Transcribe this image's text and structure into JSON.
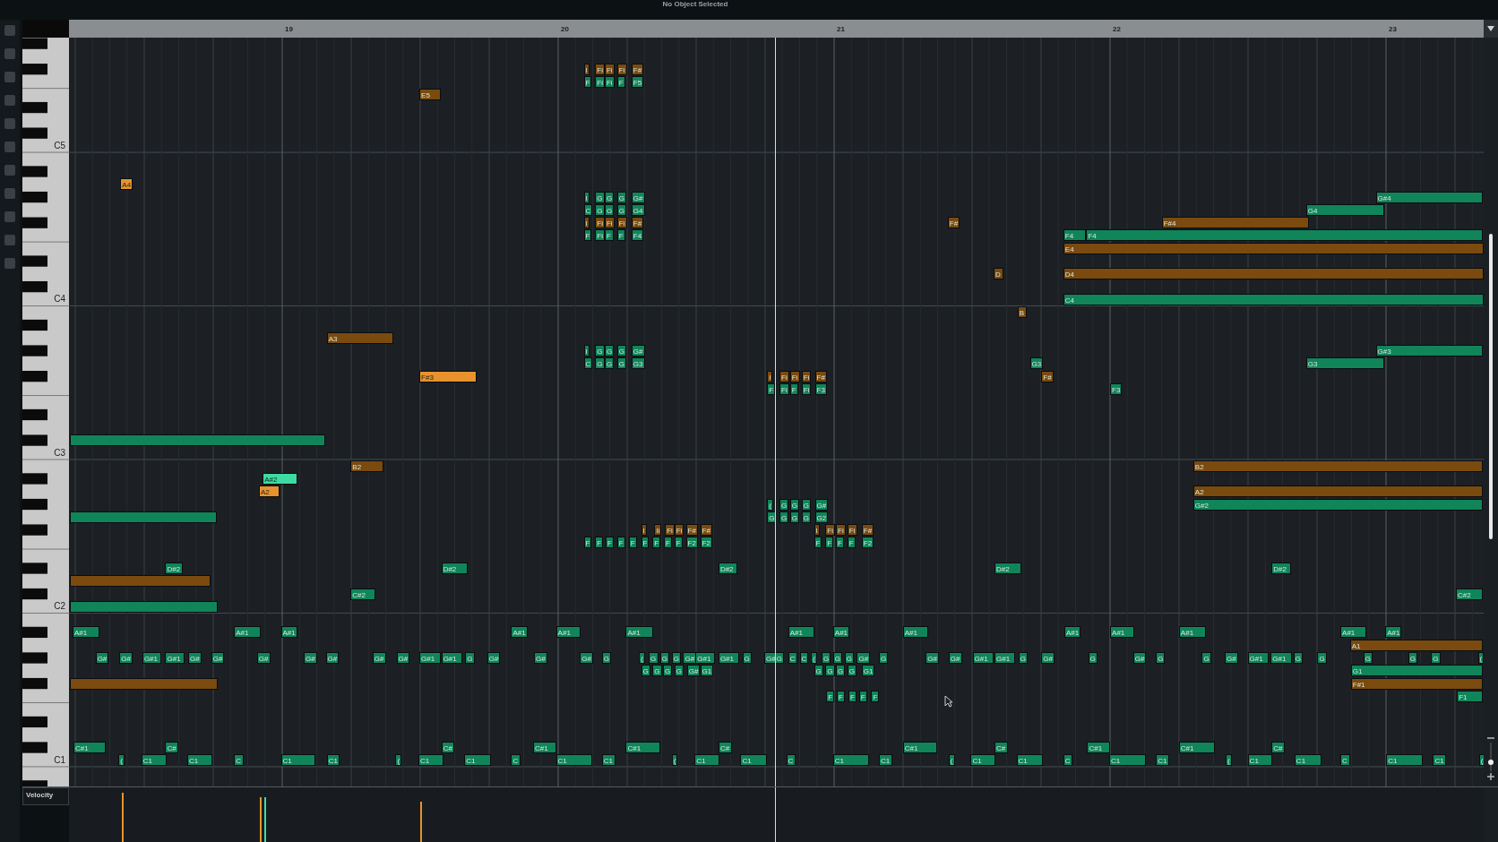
{
  "title": "No Object Selected",
  "ruler": {
    "bars": [
      "19",
      "20",
      "21",
      "22",
      "23"
    ]
  },
  "keyboard": {
    "octave_labels": [
      "C5",
      "C4",
      "C3",
      "C2",
      "C1"
    ]
  },
  "notes": [
    {
      "label": "I",
      "color": "#7a4a0e"
    },
    {
      "label": "Fi",
      "color": "#7a4a0e"
    },
    {
      "label": "Fi",
      "color": "#7a4a0e"
    },
    {
      "label": "Fi",
      "color": "#7a4a0e"
    },
    {
      "label": "F#",
      "color": "#7a4a0e"
    },
    {
      "label": "F",
      "color": "#10855a"
    },
    {
      "label": "Fi",
      "color": "#10855a"
    },
    {
      "label": "Fi",
      "color": "#10855a"
    },
    {
      "label": "F",
      "color": "#10855a"
    },
    {
      "label": "F5",
      "color": "#10855a"
    },
    {
      "label": "E5",
      "color": "#7a4a0e"
    },
    {
      "label": "A4",
      "color": "#e8922e"
    },
    {
      "label": "I",
      "color": "#10855a"
    },
    {
      "label": "G",
      "color": "#10855a"
    },
    {
      "label": "G",
      "color": "#10855a"
    },
    {
      "label": "G",
      "color": "#10855a"
    },
    {
      "label": "G#",
      "color": "#10855a"
    },
    {
      "label": "C",
      "color": "#10855a"
    },
    {
      "label": "G",
      "color": "#10855a"
    },
    {
      "label": "G",
      "color": "#10855a"
    },
    {
      "label": "G",
      "color": "#10855a"
    },
    {
      "label": "G4",
      "color": "#10855a"
    },
    {
      "label": "I",
      "color": "#7a4a0e"
    },
    {
      "label": "Fi",
      "color": "#7a4a0e"
    },
    {
      "label": "Fi",
      "color": "#7a4a0e"
    },
    {
      "label": "Fi",
      "color": "#7a4a0e"
    },
    {
      "label": "F#",
      "color": "#7a4a0e"
    },
    {
      "label": "F",
      "color": "#10855a"
    },
    {
      "label": "Fi",
      "color": "#10855a"
    },
    {
      "label": "F",
      "color": "#10855a"
    },
    {
      "label": "F",
      "color": "#10855a"
    },
    {
      "label": "F4",
      "color": "#10855a"
    },
    {
      "label": "F#",
      "color": "#7a4a0e"
    },
    {
      "label": "G#4",
      "color": "#10855a"
    },
    {
      "label": "G4",
      "color": "#10855a"
    },
    {
      "label": "F#4",
      "color": "#7a4a0e"
    },
    {
      "label": "F4",
      "color": "#10855a"
    },
    {
      "label": "F4",
      "color": "#10855a"
    },
    {
      "label": "E4",
      "color": "#7a4a0e"
    },
    {
      "label": "D",
      "color": "#7a4a0e"
    },
    {
      "label": "D4",
      "color": "#7a4a0e"
    },
    {
      "label": "C4",
      "color": "#10855a"
    },
    {
      "label": "B",
      "color": "#7a4a0e"
    },
    {
      "label": "A3",
      "color": "#7a4a0e"
    },
    {
      "label": "I",
      "color": "#10855a"
    },
    {
      "label": "G",
      "color": "#10855a"
    },
    {
      "label": "G",
      "color": "#10855a"
    },
    {
      "label": "G",
      "color": "#10855a"
    },
    {
      "label": "G#",
      "color": "#10855a"
    },
    {
      "label": "C",
      "color": "#10855a"
    },
    {
      "label": "G",
      "color": "#10855a"
    },
    {
      "label": "G",
      "color": "#10855a"
    },
    {
      "label": "G",
      "color": "#10855a"
    },
    {
      "label": "G3",
      "color": "#10855a"
    },
    {
      "label": "G#3",
      "color": "#10855a"
    },
    {
      "label": "G3",
      "color": "#10855a"
    },
    {
      "label": "G3",
      "color": "#10855a"
    },
    {
      "label": "F#",
      "color": "#7a4a0e"
    },
    {
      "label": "F3",
      "color": "#10855a"
    },
    {
      "label": "F#3",
      "color": "#e8922e"
    },
    {
      "label": "I",
      "color": "#7a4a0e"
    },
    {
      "label": "Fi",
      "color": "#7a4a0e"
    },
    {
      "label": "Fi",
      "color": "#7a4a0e"
    },
    {
      "label": "Fi",
      "color": "#7a4a0e"
    },
    {
      "label": "F#",
      "color": "#7a4a0e"
    },
    {
      "label": "F",
      "color": "#10855a"
    },
    {
      "label": "Fi",
      "color": "#10855a"
    },
    {
      "label": "F",
      "color": "#10855a"
    },
    {
      "label": "Fi",
      "color": "#10855a"
    },
    {
      "label": "F3",
      "color": "#10855a"
    },
    {
      "color": "#10855a"
    },
    {
      "label": "B2",
      "color": "#7a4a0e"
    },
    {
      "label": "B2",
      "color": "#7a4a0e"
    },
    {
      "label": "A#2",
      "color": "#3ddba2"
    },
    {
      "label": "A2",
      "color": "#e8922e"
    },
    {
      "label": "A2",
      "color": "#7a4a0e"
    },
    {
      "label": "(",
      "color": "#10855a"
    },
    {
      "label": "G",
      "color": "#10855a"
    },
    {
      "label": "G",
      "color": "#10855a"
    },
    {
      "label": "G",
      "color": "#10855a"
    },
    {
      "label": "G#",
      "color": "#10855a"
    },
    {
      "label": "G#2",
      "color": "#10855a"
    },
    {
      "label": "G",
      "color": "#10855a"
    },
    {
      "label": "G",
      "color": "#10855a"
    },
    {
      "label": "G",
      "color": "#10855a"
    },
    {
      "label": "G",
      "color": "#10855a"
    },
    {
      "label": "G2",
      "color": "#10855a"
    },
    {
      "color": "#10855a"
    },
    {
      "label": "I",
      "color": "#7a4a0e"
    },
    {
      "label": "Ii",
      "color": "#7a4a0e"
    },
    {
      "label": "Fi",
      "color": "#7a4a0e"
    },
    {
      "label": "Fi",
      "color": "#7a4a0e"
    },
    {
      "label": "F#",
      "color": "#7a4a0e"
    },
    {
      "label": "F#",
      "color": "#7a4a0e"
    },
    {
      "label": "I",
      "color": "#7a4a0e"
    },
    {
      "label": "Fi",
      "color": "#7a4a0e"
    },
    {
      "label": "Fi",
      "color": "#7a4a0e"
    },
    {
      "label": "Fi",
      "color": "#7a4a0e"
    },
    {
      "label": "F#",
      "color": "#7a4a0e"
    },
    {
      "label": "F",
      "color": "#10855a"
    },
    {
      "label": "F",
      "color": "#10855a"
    },
    {
      "label": "F",
      "color": "#10855a"
    },
    {
      "label": "F",
      "color": "#10855a"
    },
    {
      "label": "F",
      "color": "#10855a"
    },
    {
      "label": "F",
      "color": "#10855a"
    },
    {
      "label": "F",
      "color": "#10855a"
    },
    {
      "label": "F",
      "color": "#10855a"
    },
    {
      "label": "F",
      "color": "#10855a"
    },
    {
      "label": "F2",
      "color": "#10855a"
    },
    {
      "label": "F2",
      "color": "#10855a"
    },
    {
      "label": "F",
      "color": "#10855a"
    },
    {
      "label": "F",
      "color": "#10855a"
    },
    {
      "label": "F",
      "color": "#10855a"
    },
    {
      "label": "F",
      "color": "#10855a"
    },
    {
      "label": "F2",
      "color": "#10855a"
    },
    {
      "label": "D#2",
      "color": "#10855a"
    },
    {
      "label": "D#2",
      "color": "#10855a"
    },
    {
      "label": "D#2",
      "color": "#10855a"
    },
    {
      "label": "D#2",
      "color": "#10855a"
    },
    {
      "label": "D#2",
      "color": "#10855a"
    },
    {
      "color": "#7a4a0e"
    },
    {
      "label": "C#2",
      "color": "#10855a"
    },
    {
      "label": "C#2",
      "color": "#10855a"
    },
    {
      "color": "#10855a"
    },
    {
      "label": "A#1",
      "color": "#10855a"
    },
    {
      "label": "A#1",
      "color": "#10855a"
    },
    {
      "label": "A#1",
      "color": "#10855a"
    },
    {
      "label": "A#1",
      "color": "#10855a"
    },
    {
      "label": "A#1",
      "color": "#10855a"
    },
    {
      "label": "A#1",
      "color": "#10855a"
    },
    {
      "label": "A#1",
      "color": "#10855a"
    },
    {
      "label": "A#1",
      "color": "#10855a"
    },
    {
      "label": "A#1",
      "color": "#10855a"
    },
    {
      "label": "A#1",
      "color": "#10855a"
    },
    {
      "label": "A#1",
      "color": "#10855a"
    },
    {
      "label": "A#1",
      "color": "#10855a"
    },
    {
      "label": "A#1",
      "color": "#10855a"
    },
    {
      "label": "A#1",
      "color": "#10855a"
    },
    {
      "label": "A1",
      "color": "#7a4a0e"
    },
    {
      "label": "G#",
      "color": "#10855a"
    },
    {
      "label": "G#",
      "color": "#10855a"
    },
    {
      "label": "G#1",
      "color": "#10855a"
    },
    {
      "label": "G#1",
      "color": "#10855a"
    },
    {
      "label": "G#",
      "color": "#10855a"
    },
    {
      "label": "G#",
      "color": "#10855a"
    },
    {
      "label": "G#",
      "color": "#10855a"
    },
    {
      "label": "G#",
      "color": "#10855a"
    },
    {
      "label": "G#",
      "color": "#10855a"
    },
    {
      "label": "G#",
      "color": "#10855a"
    },
    {
      "label": "G#",
      "color": "#10855a"
    },
    {
      "label": "G#1",
      "color": "#10855a"
    },
    {
      "label": "G#1",
      "color": "#10855a"
    },
    {
      "label": "G",
      "color": "#10855a"
    },
    {
      "label": "G#",
      "color": "#10855a"
    },
    {
      "label": "G#",
      "color": "#10855a"
    },
    {
      "label": "G#",
      "color": "#10855a"
    },
    {
      "label": "G",
      "color": "#10855a"
    },
    {
      "label": "(",
      "color": "#10855a"
    },
    {
      "label": "G",
      "color": "#10855a"
    },
    {
      "label": "G",
      "color": "#10855a"
    },
    {
      "label": "G",
      "color": "#10855a"
    },
    {
      "label": "G#",
      "color": "#10855a"
    },
    {
      "label": "G#1",
      "color": "#10855a"
    },
    {
      "label": "G#1",
      "color": "#10855a"
    },
    {
      "label": "G",
      "color": "#10855a"
    },
    {
      "label": "G#",
      "color": "#10855a"
    },
    {
      "label": "G",
      "color": "#10855a"
    },
    {
      "label": "C",
      "color": "#10855a"
    },
    {
      "label": "C",
      "color": "#10855a"
    },
    {
      "label": "(",
      "color": "#10855a"
    },
    {
      "label": "G",
      "color": "#10855a"
    },
    {
      "label": "G",
      "color": "#10855a"
    },
    {
      "label": "G",
      "color": "#10855a"
    },
    {
      "label": "G#",
      "color": "#10855a"
    },
    {
      "label": "G",
      "color": "#10855a"
    },
    {
      "label": "G#",
      "color": "#10855a"
    },
    {
      "label": "G#",
      "color": "#10855a"
    },
    {
      "label": "G#1",
      "color": "#10855a"
    },
    {
      "label": "G#1",
      "color": "#10855a"
    },
    {
      "label": "G",
      "color": "#10855a"
    },
    {
      "label": "G#",
      "color": "#10855a"
    },
    {
      "label": "G",
      "color": "#10855a"
    },
    {
      "label": "G#",
      "color": "#10855a"
    },
    {
      "label": "G",
      "color": "#10855a"
    },
    {
      "label": "G",
      "color": "#10855a"
    },
    {
      "label": "G#",
      "color": "#10855a"
    },
    {
      "label": "G#1",
      "color": "#10855a"
    },
    {
      "label": "G#1",
      "color": "#10855a"
    },
    {
      "label": "G",
      "color": "#10855a"
    },
    {
      "label": "G",
      "color": "#10855a"
    },
    {
      "label": "G",
      "color": "#10855a"
    },
    {
      "label": "G",
      "color": "#10855a"
    },
    {
      "label": "G",
      "color": "#10855a"
    },
    {
      "label": "(",
      "color": "#10855a"
    },
    {
      "label": "G",
      "color": "#10855a"
    },
    {
      "label": "G",
      "color": "#10855a"
    },
    {
      "label": "G",
      "color": "#10855a"
    },
    {
      "label": "G",
      "color": "#10855a"
    },
    {
      "label": "G#",
      "color": "#10855a"
    },
    {
      "label": "G1",
      "color": "#10855a"
    },
    {
      "label": "G",
      "color": "#10855a"
    },
    {
      "label": "G",
      "color": "#10855a"
    },
    {
      "label": "G",
      "color": "#10855a"
    },
    {
      "label": "G",
      "color": "#10855a"
    },
    {
      "label": "G1",
      "color": "#10855a"
    },
    {
      "label": "G1",
      "color": "#10855a"
    },
    {
      "color": "#7a4a0e"
    },
    {
      "label": "F#1",
      "color": "#7a4a0e"
    },
    {
      "label": "F",
      "color": "#10855a"
    },
    {
      "label": "F",
      "color": "#10855a"
    },
    {
      "label": "F",
      "color": "#10855a"
    },
    {
      "label": "F",
      "color": "#10855a"
    },
    {
      "label": "F",
      "color": "#10855a"
    },
    {
      "label": "F1",
      "color": "#10855a"
    },
    {
      "label": "C#1",
      "color": "#10855a"
    },
    {
      "label": "C#",
      "color": "#10855a"
    },
    {
      "label": "C#",
      "color": "#10855a"
    },
    {
      "label": "C#1",
      "color": "#10855a"
    },
    {
      "label": "C#1",
      "color": "#10855a"
    },
    {
      "label": "C#",
      "color": "#10855a"
    },
    {
      "label": "C#1",
      "color": "#10855a"
    },
    {
      "label": "C#",
      "color": "#10855a"
    },
    {
      "label": "C#1",
      "color": "#10855a"
    },
    {
      "label": "C#1",
      "color": "#10855a"
    },
    {
      "label": "C#",
      "color": "#10855a"
    },
    {
      "label": "(",
      "color": "#10855a"
    },
    {
      "label": "C1",
      "color": "#10855a"
    },
    {
      "label": "C1",
      "color": "#10855a"
    },
    {
      "label": "C",
      "color": "#10855a"
    },
    {
      "label": "C1",
      "color": "#10855a"
    },
    {
      "label": "C1",
      "color": "#10855a"
    },
    {
      "label": "(",
      "color": "#10855a"
    },
    {
      "label": "C1",
      "color": "#10855a"
    },
    {
      "label": "C1",
      "color": "#10855a"
    },
    {
      "label": "C",
      "color": "#10855a"
    },
    {
      "label": "C1",
      "color": "#10855a"
    },
    {
      "label": "C1",
      "color": "#10855a"
    },
    {
      "label": "(",
      "color": "#10855a"
    },
    {
      "label": "C1",
      "color": "#10855a"
    },
    {
      "label": "C1",
      "color": "#10855a"
    },
    {
      "label": "C",
      "color": "#10855a"
    },
    {
      "label": "C1",
      "color": "#10855a"
    },
    {
      "label": "C1",
      "color": "#10855a"
    },
    {
      "label": "(",
      "color": "#10855a"
    },
    {
      "label": "C1",
      "color": "#10855a"
    },
    {
      "label": "C1",
      "color": "#10855a"
    },
    {
      "label": "C",
      "color": "#10855a"
    },
    {
      "label": "C1",
      "color": "#10855a"
    },
    {
      "label": "C1",
      "color": "#10855a"
    },
    {
      "label": "(",
      "color": "#10855a"
    },
    {
      "label": "C1",
      "color": "#10855a"
    },
    {
      "label": "C1",
      "color": "#10855a"
    },
    {
      "label": "C",
      "color": "#10855a"
    },
    {
      "label": "C1",
      "color": "#10855a"
    },
    {
      "label": "C1",
      "color": "#10855a"
    },
    {
      "label": "(",
      "color": "#10855a"
    }
  ],
  "velocity_lane": {
    "label": "Velocity",
    "bars": [
      {
        "color": "#e8922e"
      },
      {
        "color": "#e8922e"
      },
      {
        "color": "#3ddba2"
      },
      {
        "color": "#e8922e"
      }
    ]
  }
}
